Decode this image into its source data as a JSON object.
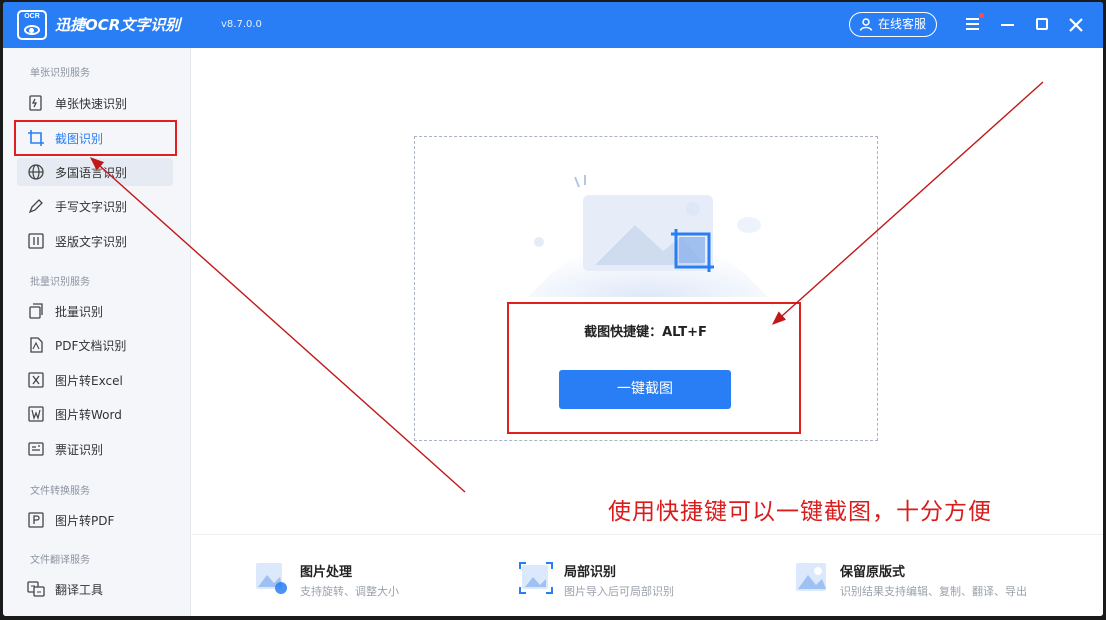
{
  "app": {
    "logo_text": "OCR",
    "title": "迅捷OCR文字识别",
    "version": "v8.7.0.0",
    "service_label": "在线客服"
  },
  "sidebar": {
    "sections": [
      {
        "title": "单张识别服务",
        "items": [
          {
            "label": "单张快速识别",
            "icon": "single-photo-icon"
          },
          {
            "label": "截图识别",
            "icon": "crop-icon",
            "active": true
          },
          {
            "label": "多国语言识别",
            "icon": "globe-icon"
          },
          {
            "label": "手写文字识别",
            "icon": "pen-icon"
          },
          {
            "label": "竖版文字识别",
            "icon": "vertical-text-icon"
          }
        ]
      },
      {
        "title": "批量识别服务",
        "items": [
          {
            "label": "批量识别",
            "icon": "batch-icon"
          },
          {
            "label": "PDF文档识别",
            "icon": "pdf-icon"
          },
          {
            "label": "图片转Excel",
            "icon": "excel-icon"
          },
          {
            "label": "图片转Word",
            "icon": "word-icon"
          },
          {
            "label": "票证识别",
            "icon": "ticket-icon"
          }
        ]
      },
      {
        "title": "文件转换服务",
        "items": [
          {
            "label": "图片转PDF",
            "icon": "pdf-convert-icon"
          }
        ]
      },
      {
        "title": "文件翻译服务",
        "items": [
          {
            "label": "翻译工具",
            "icon": "translate-icon"
          }
        ]
      }
    ]
  },
  "main": {
    "shortcut_text": "截图快捷键：ALT+F",
    "capture_button": "一键截图",
    "features": [
      {
        "title": "图片处理",
        "desc": "支持旋转、调整大小"
      },
      {
        "title": "局部识别",
        "desc": "图片导入后可局部识别"
      },
      {
        "title": "保留原版式",
        "desc": "识别结果支持编辑、复制、翻译、导出"
      }
    ]
  },
  "annotation": {
    "text": "使用快捷键可以一键截图，十分方便",
    "color": "#d91c1c"
  },
  "colors": {
    "accent": "#2a7ef5",
    "sidebar_bg": "#f4f6fa"
  }
}
